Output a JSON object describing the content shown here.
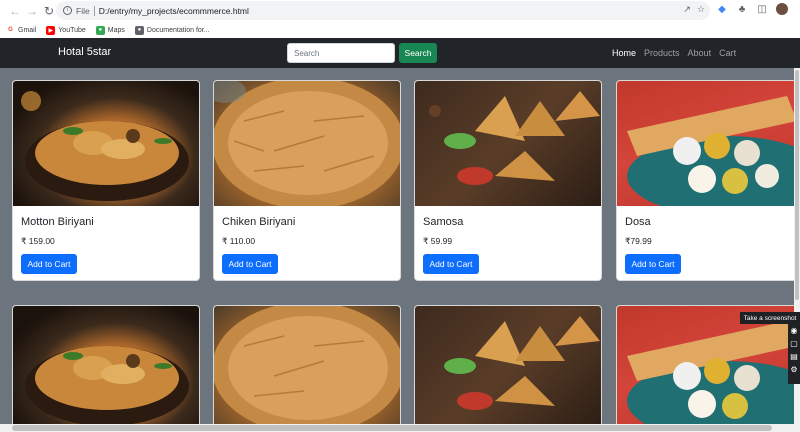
{
  "browser": {
    "file_label": "File",
    "url": "D:/entry/my_projects/ecommmerce.html",
    "bookmarks": [
      {
        "label": "Gmail",
        "icon": "gmail-icon",
        "color": "#ea4335"
      },
      {
        "label": "YouTube",
        "icon": "youtube-icon",
        "color": "#ff0000"
      },
      {
        "label": "Maps",
        "icon": "maps-icon",
        "color": "#34a853"
      },
      {
        "label": "Documentation for...",
        "icon": "globe-icon",
        "color": "#5f6368"
      }
    ]
  },
  "navbar": {
    "brand": "Hotal 5star",
    "search_placeholder": "Search",
    "search_button": "Search",
    "links": [
      "Home",
      "Products",
      "About",
      "Cart"
    ],
    "active_link": "Home"
  },
  "products": [
    {
      "name": "Motton Biriyani",
      "price": "₹ 159.00",
      "button": "Add to Cart",
      "image": "biryani-mutton"
    },
    {
      "name": "Chiken Biriyani",
      "price": "₹ 110.00",
      "button": "Add to Cart",
      "image": "biryani-chicken"
    },
    {
      "name": "Samosa",
      "price": "₹ 59.99",
      "button": "Add to Cart",
      "image": "samosa"
    },
    {
      "name": "Dosa",
      "price": "₹79.99",
      "button": "Add to Cart",
      "image": "dosa"
    }
  ],
  "widget": {
    "tooltip": "Take a screenshot"
  },
  "colors": {
    "navbar_bg": "#212529",
    "main_bg": "#6c757d",
    "search_btn": "#198754",
    "primary_btn": "#0d6efd"
  }
}
